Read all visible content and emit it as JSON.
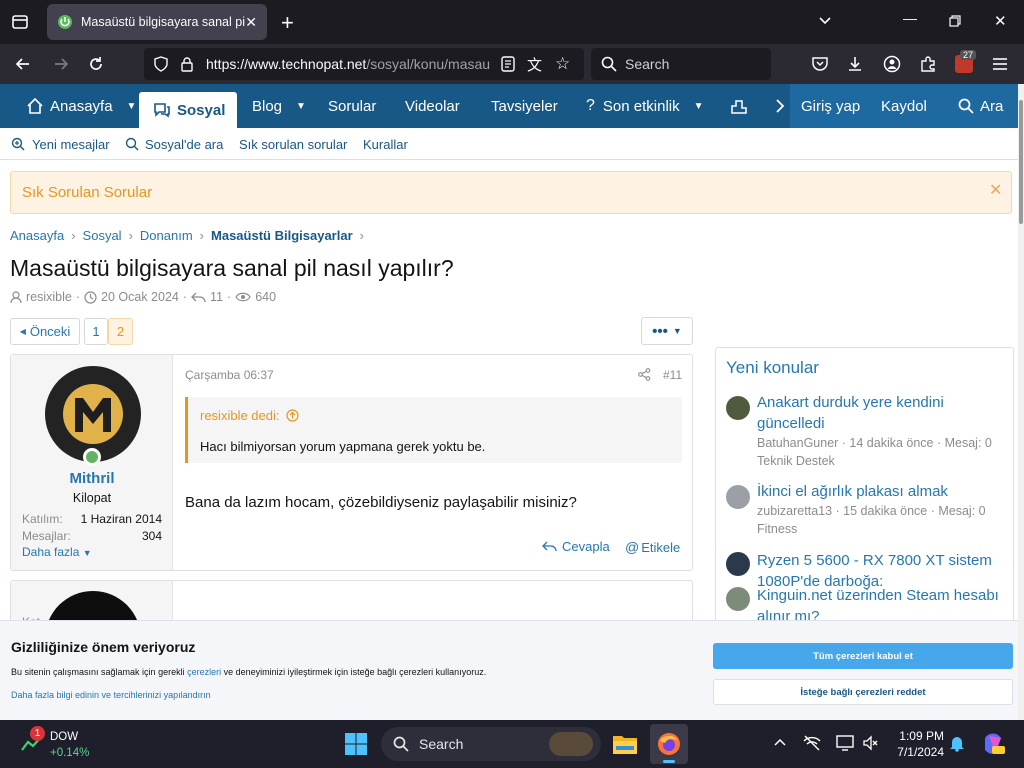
{
  "browser": {
    "tab_title": "Masaüstü bilgisayara sanal pil na",
    "url_host": "https://www.technopat.net",
    "url_rest": "/sosyal/konu/masau",
    "search_placeholder": "Search",
    "extension_badge": "27"
  },
  "nav": {
    "home": "Anasayfa",
    "social": "Sosyal",
    "blog": "Blog",
    "questions": "Sorular",
    "videos": "Videolar",
    "recommendations": "Tavsiyeler",
    "recent_activity": "Son etkinlik",
    "login": "Giriş yap",
    "register": "Kaydol",
    "search": "Ara"
  },
  "subnav": {
    "new_messages": "Yeni mesajlar",
    "search_social": "Sosyal'de ara",
    "faq": "Sık sorulan sorular",
    "rules": "Kurallar"
  },
  "notice": {
    "text": "Sık Sorulan Sorular"
  },
  "breadcrumb": [
    "Anasayfa",
    "Sosyal",
    "Donanım",
    "Masaüstü Bilgisayarlar"
  ],
  "thread": {
    "title": "Masaüstü bilgisayara sanal pil nasıl yapılır?",
    "author": "resixible",
    "date": "20 Ocak 2024",
    "replies": "11",
    "views": "640"
  },
  "pagination": {
    "prev": "Önceki",
    "pages": [
      "1",
      "2"
    ],
    "current": "2"
  },
  "post": {
    "username": "Mithril",
    "user_title": "Kilopat",
    "joined_label": "Katılım:",
    "joined_value": "1 Haziran 2014",
    "messages_label": "Mesajlar:",
    "messages_value": "304",
    "more": "Daha fazla",
    "date": "Çarşamba 06:37",
    "number": "#11",
    "quote_author": "resixible dedi:",
    "quote_text": "Hacı bilmiyorsan yorum yapmana gerek yoktu be.",
    "body": "Bana da lazım hocam, çözebildiyseniz paylaşabilir misiniz?",
    "reply": "Cevapla",
    "tag": "Etikele"
  },
  "post2": {
    "username_partial": "Kat"
  },
  "sidebar": {
    "title": "Yeni konular",
    "items": [
      {
        "title": "Anakart durduk yere kendini güncelledi",
        "meta1": "BatuhanGuner · 14 dakika önce · Mesaj: 0",
        "meta2": "Teknik Destek"
      },
      {
        "title": "İkinci el ağırlık plakası almak",
        "meta1": "zubizaretta13 · 15 dakika önce · Mesaj: 0",
        "meta2": "Fitness"
      },
      {
        "title": "Ryzen 5 5600 - RX 7800 XT sistem 1080P'de darboğa:",
        "meta1": "",
        "meta2": ""
      },
      {
        "title": "Kinguin.net üzerinden Steam hesabı alınır mı?",
        "meta1": "",
        "meta2": ""
      }
    ]
  },
  "cookie": {
    "title": "Gizliliğinize önem veriyoruz",
    "text_before": "Bu sitenin çalışmasını sağlamak için gerekli ",
    "text_link": "çerezleri",
    "text_after": " ve deneyiminizi iyileştirmek için isteğe bağlı çerezleri kullanıyoruz.",
    "more": "Daha fazla bilgi edinin ve tercihlerinizi yapılandırın",
    "accept": "Tüm çerezleri kabul et",
    "reject": "İsteğe bağlı çerezleri reddet"
  },
  "taskbar": {
    "ticker_badge": "1",
    "ticker_name": "DOW",
    "ticker_change": "+0.14%",
    "search": "Search",
    "time": "1:09 PM",
    "date": "7/1/2024"
  },
  "colors": {
    "brand": "#185886",
    "link": "#2577b1",
    "accent": "#e89520",
    "accept": "#47a7eb"
  }
}
